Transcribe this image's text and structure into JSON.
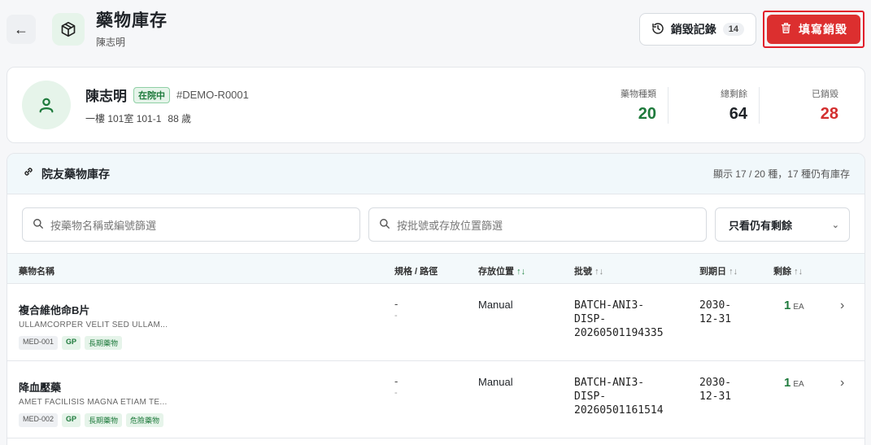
{
  "header": {
    "title": "藥物庫存",
    "subtitle": "陳志明",
    "history_label": "銷毀記錄",
    "history_count": "14",
    "dispose_label": "填寫銷毀"
  },
  "resident": {
    "name": "陳志明",
    "status": "在院中",
    "id": "#DEMO-R0001",
    "room": "一樓 101室 101-1",
    "age": "88 歲",
    "stats": [
      {
        "label": "藥物種類",
        "value": "20",
        "color": "#1e7a3c"
      },
      {
        "label": "總剩餘",
        "value": "64",
        "color": "#1f2328"
      },
      {
        "label": "已銷毀",
        "value": "28",
        "color": "#d32f2f"
      }
    ]
  },
  "inventory": {
    "title": "院友藥物庫存",
    "summary": "顯示 17 / 20 種，17 種仍有庫存",
    "search_name_placeholder": "按藥物名稱或編號篩選",
    "search_batch_placeholder": "按批號或存放位置篩選",
    "filter_select": "只看仍有剩餘",
    "columns": {
      "name": "藥物名稱",
      "spec": "規格 / 路徑",
      "location": "存放位置",
      "batch": "批號",
      "expiry": "到期日",
      "remaining": "剩餘"
    },
    "rows": [
      {
        "name": "複合維他命B片",
        "sub": "ULLAMCORPER VELIT SED ULLAM...",
        "tags": [
          "MED-001",
          "GP",
          "長期藥物"
        ],
        "spec1": "-",
        "spec2": "-",
        "location": "Manual",
        "batch1": "BATCH-ANI3-",
        "batch2": "DISP-",
        "batch3": "20260501194335",
        "expiry1": "2030-",
        "expiry2": "12-31",
        "remaining": "1",
        "unit": "EA"
      },
      {
        "name": "降血壓藥",
        "sub": "AMET FACILISIS MAGNA ETIAM TE...",
        "tags": [
          "MED-002",
          "GP",
          "長期藥物",
          "危險藥物"
        ],
        "spec1": "-",
        "spec2": "-",
        "location": "Manual",
        "batch1": "BATCH-ANI3-",
        "batch2": "DISP-",
        "batch3": "20260501161514",
        "expiry1": "2030-",
        "expiry2": "12-31",
        "remaining": "1",
        "unit": "EA"
      }
    ]
  }
}
